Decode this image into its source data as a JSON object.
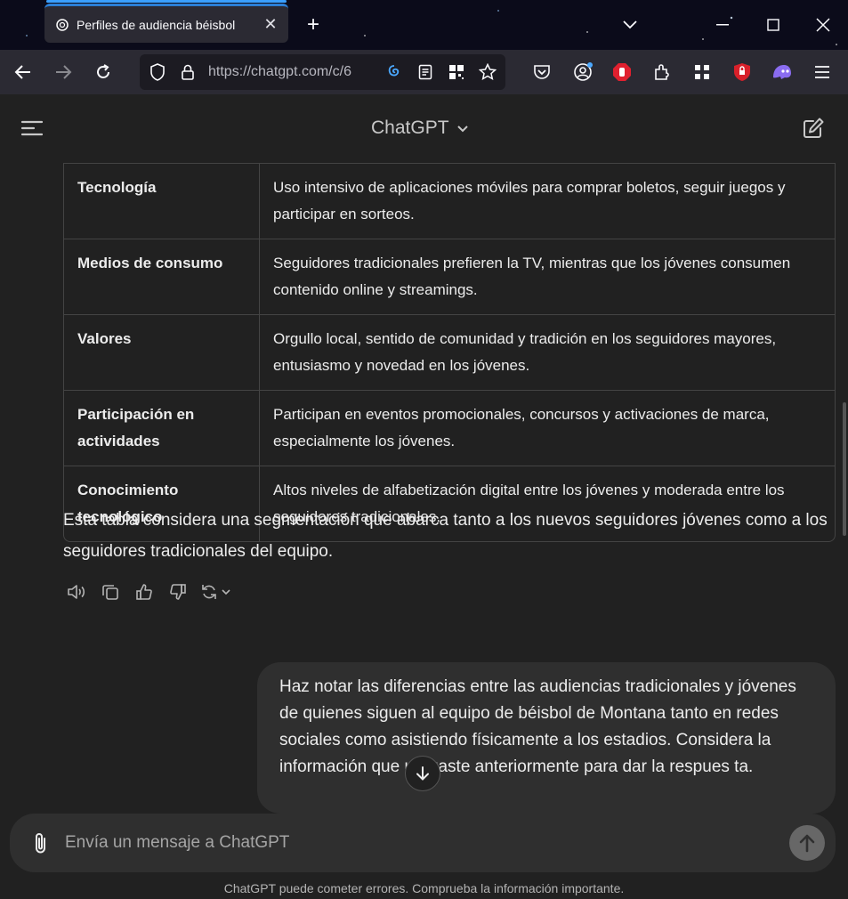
{
  "browser": {
    "tab_title": "Perfiles de audiencia béisbol",
    "tab_close": "✕",
    "new_tab": "+",
    "url": "https://chatgpt.com/c/6"
  },
  "app": {
    "title": "ChatGPT"
  },
  "table": {
    "rows": [
      {
        "label": "Tecnología",
        "value": "Uso intensivo de aplicaciones móviles para comprar boletos, seguir juegos y participar en sorteos."
      },
      {
        "label": "Medios de consumo",
        "value": "Seguidores tradicionales prefieren la TV, mientras que los jóvenes consumen contenido online y streamings."
      },
      {
        "label": "Valores",
        "value": "Orgullo local, sentido de comunidad y tradición en los seguidores mayores, entusiasmo y novedad en los jóvenes."
      },
      {
        "label": "Participación en actividades",
        "value": "Participan en eventos promocionales, concursos y activaciones de marca, especialmente los jóvenes."
      },
      {
        "label": "Conocimiento tecnológico",
        "value": "Altos niveles de alfabetización digital entre los jóvenes y moderada entre los seguidores tradicionales."
      }
    ]
  },
  "assistant_paragraph": "Esta tabla considera una segmentación que abarca tanto a los nuevos seguidores jóvenes como a los seguidores tradicionales del equipo.",
  "user_message": "Haz notar las diferencias entre las audiencias tradicionales y jóvenes de quienes siguen al equipo de béisbol de Montana tanto en redes sociales como asistiendo físicamente a los estadios. Considera la información que utilizaste anteriormente para dar la respues ta.",
  "composer": {
    "placeholder": "Envía un mensaje a ChatGPT"
  },
  "footer": "ChatGPT puede cometer errores. Comprueba la información importante.",
  "colors": {
    "background": "#212121",
    "bubble": "#2f2f2f",
    "tab_accent": "#2b7fd6"
  },
  "icons": [
    "openai-favicon-icon",
    "close-icon",
    "plus-icon",
    "chevron-down-icon",
    "minimize-icon",
    "maximize-icon",
    "close-window-icon",
    "back-icon",
    "forward-icon",
    "reload-icon",
    "shield-icon",
    "lock-icon",
    "spiral-icon",
    "reader-icon",
    "qr-icon",
    "star-icon",
    "pocket-icon",
    "account-icon",
    "adblock-icon",
    "extensions-icon",
    "grid-extension-icon",
    "ublock-icon",
    "ghost-icon",
    "menu-icon",
    "sidebar-toggle-icon",
    "new-chat-icon",
    "read-aloud-icon",
    "copy-icon",
    "thumbs-up-icon",
    "thumbs-down-icon",
    "regenerate-icon",
    "arrow-down-icon",
    "paperclip-icon",
    "send-arrow-icon"
  ]
}
